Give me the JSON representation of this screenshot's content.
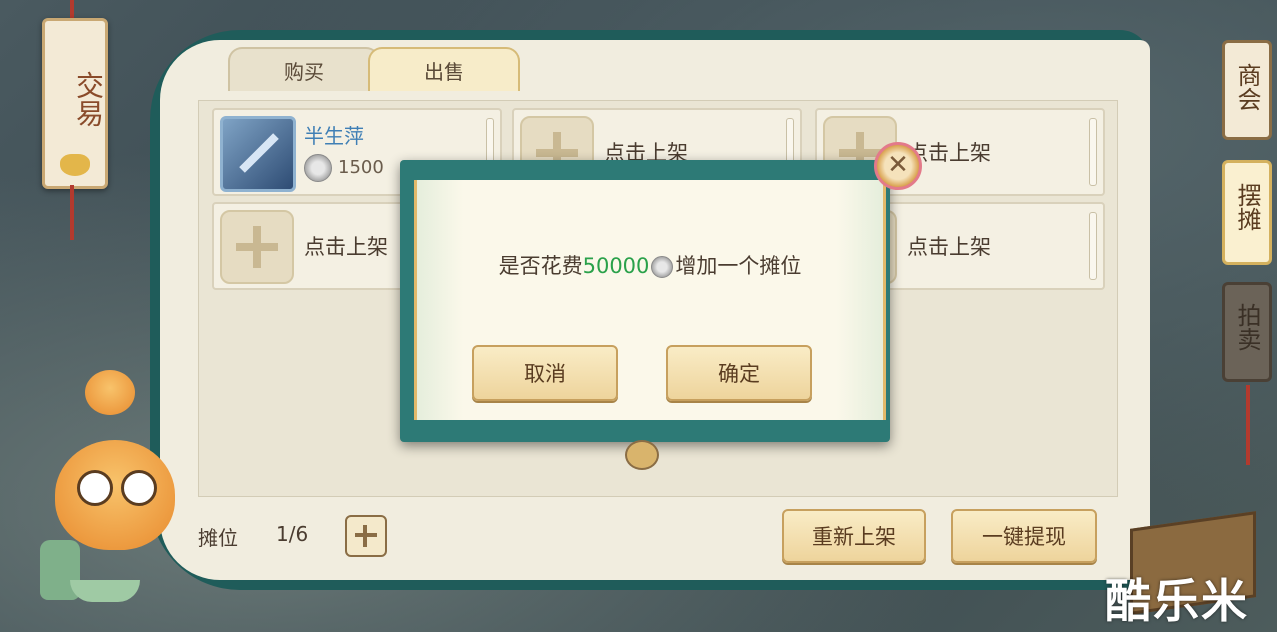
{
  "left_banner": {
    "title": "交易"
  },
  "tabs": {
    "buy_label": "购买",
    "sell_label": "出售"
  },
  "slots": [
    {
      "type": "item",
      "name": "半生萍",
      "price": "1500"
    },
    {
      "type": "empty",
      "label": "点击上架"
    },
    {
      "type": "empty",
      "label": "点击上架"
    },
    {
      "type": "empty",
      "label": "点击上架"
    },
    {
      "type": "empty",
      "label": "点击上架"
    }
  ],
  "footer": {
    "stall_label": "摊位",
    "stall_count": "1/6",
    "relist_label": "重新上架",
    "withdraw_label": "一键提现"
  },
  "side_tabs": {
    "commerce": "商会",
    "stall": "摆摊",
    "auction": "拍卖"
  },
  "dialog": {
    "message_before": "是否花费",
    "amount": "50000",
    "currency_icon": "silver-coin-icon",
    "message_after": "增加一个摊位",
    "cancel_label": "取消",
    "confirm_label": "确定"
  },
  "watermark": "酷乐米",
  "colors": {
    "panel_teal": "#1f5c5a",
    "highlight_green": "#2aa14a",
    "item_name_blue": "#3f7fb5"
  }
}
